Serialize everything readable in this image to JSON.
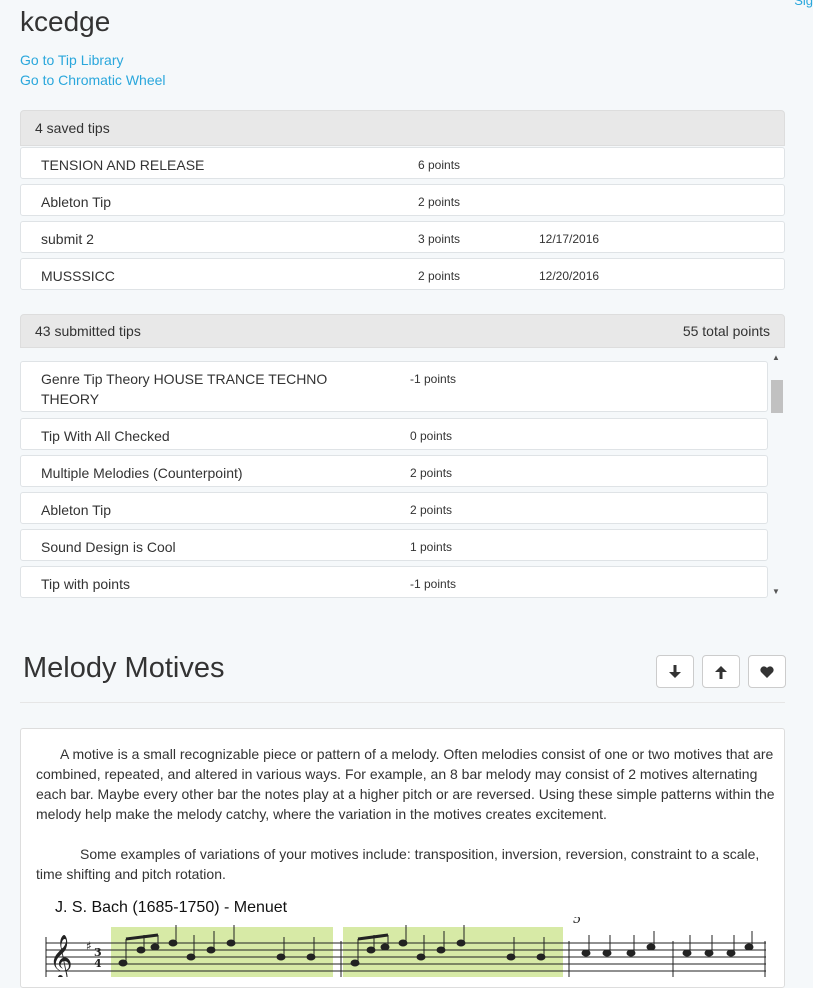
{
  "header": {
    "corner_link": "Sig",
    "username": "kcedge",
    "links": [
      "Go to Tip Library",
      "Go to Chromatic Wheel"
    ]
  },
  "saved": {
    "heading": "4 saved tips",
    "items": [
      {
        "title": "TENSION AND RELEASE",
        "points": "6 points",
        "date": ""
      },
      {
        "title": "Ableton Tip",
        "points": "2 points",
        "date": ""
      },
      {
        "title": "submit 2",
        "points": "3 points",
        "date": "12/17/2016"
      },
      {
        "title": "MUSSSICC",
        "points": "2 points",
        "date": "12/20/2016"
      }
    ]
  },
  "submitted": {
    "heading": "43 submitted tips",
    "total": "55 total points",
    "items": [
      {
        "title": "Genre Tip Theory HOUSE TRANCE TECHNO THEORY",
        "points": "-1 points"
      },
      {
        "title": "Tip With All Checked",
        "points": "0 points"
      },
      {
        "title": "Multiple Melodies (Counterpoint)",
        "points": "2 points"
      },
      {
        "title": "Ableton Tip",
        "points": "2 points"
      },
      {
        "title": "Sound Design is Cool",
        "points": "1 points"
      },
      {
        "title": "Tip with points",
        "points": "-1 points"
      }
    ]
  },
  "tip": {
    "title": "Melody Motives",
    "paragraph1": "A motive is a small recognizable piece or pattern of a melody.  Often melodies consist of one or two motives that are combined, repeated, and altered in various ways. For example, an 8 bar melody may consist of 2 motives alternating each bar.  Maybe every other bar the notes play at a higher pitch or are reversed. Using these simple patterns within the melody help make the melody catchy, where the variation in the motives creates excitement.",
    "paragraph2": "Some examples of variations of your motives include: transposition, inversion, reversion, constraint to a scale, time shifting and pitch rotation.",
    "sheet_title": "J. S. Bach (1685-1750) - Menuet",
    "measure_number": "5",
    "highlight_color": "#d7eaa6"
  },
  "icons": {
    "download": "arrow-down-icon",
    "upload": "arrow-up-icon",
    "favorite": "heart-icon"
  }
}
